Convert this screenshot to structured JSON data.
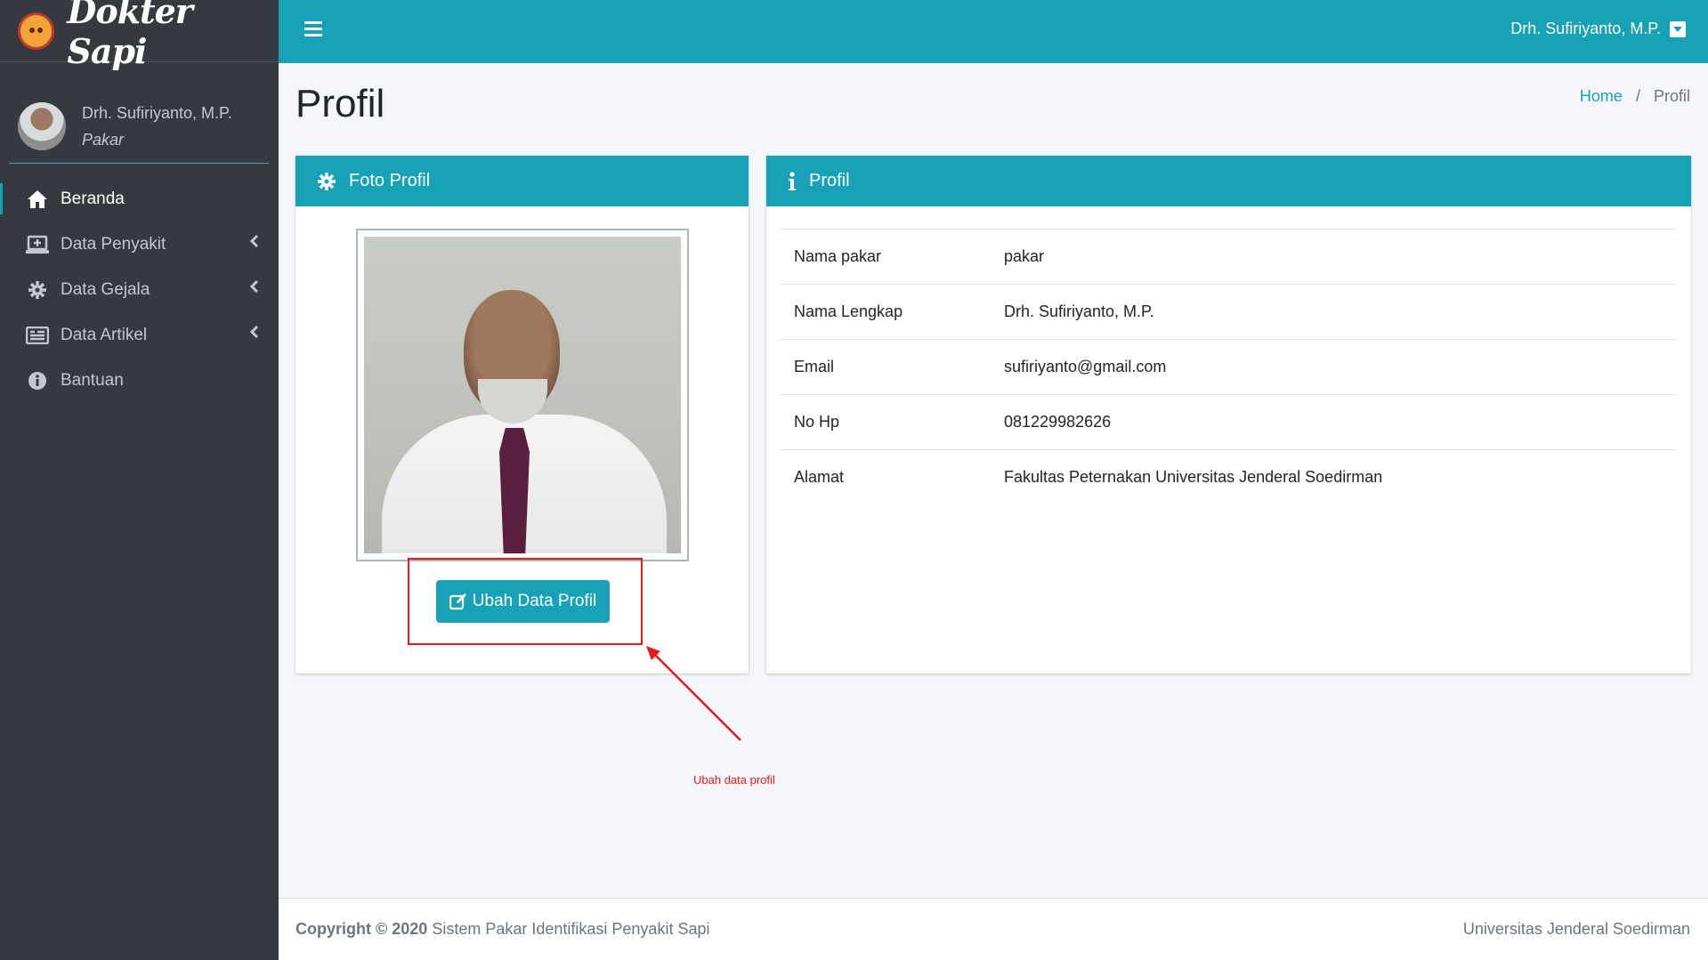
{
  "brand": {
    "name": "Dokter Sapi",
    "logo_icon": "cow-logo-icon"
  },
  "sidebar": {
    "user": {
      "name": "Drh. Sufiriyanto, M.P.",
      "role": "Pakar"
    },
    "items": [
      {
        "label": "Beranda",
        "icon": "home-icon",
        "active": true,
        "has_children": false
      },
      {
        "label": "Data Penyakit",
        "icon": "laptop-medical-icon",
        "active": false,
        "has_children": true
      },
      {
        "label": "Data Gejala",
        "icon": "cog-icon",
        "active": false,
        "has_children": true
      },
      {
        "label": "Data Artikel",
        "icon": "newspaper-icon",
        "active": false,
        "has_children": true
      },
      {
        "label": "Bantuan",
        "icon": "info-circle-icon",
        "active": false,
        "has_children": false
      }
    ]
  },
  "topbar": {
    "user_name": "Drh. Sufiriyanto, M.P."
  },
  "page": {
    "title": "Profil",
    "breadcrumb": {
      "home": "Home",
      "separator": "/",
      "current": "Profil"
    }
  },
  "photo_card": {
    "title": "Foto Profil",
    "button_label": "Ubah Data Profil"
  },
  "profile_card": {
    "title": "Profil",
    "rows": [
      {
        "label": "Nama pakar",
        "value": "pakar"
      },
      {
        "label": "Nama Lengkap",
        "value": "Drh. Sufiriyanto, M.P."
      },
      {
        "label": "Email",
        "value": "sufiriyanto@gmail.com"
      },
      {
        "label": "No Hp",
        "value": "081229982626"
      },
      {
        "label": "Alamat",
        "value": "Fakultas Peternakan Universitas Jenderal Soedirman"
      }
    ]
  },
  "annotation": {
    "text": "Ubah data profil",
    "color": "#e41a1a"
  },
  "footer": {
    "copyright_bold": "Copyright © 2020",
    "copyright_text": "Sistem Pakar Identifikasi Penyakit Sapi",
    "right_text": "Universitas Jenderal Soedirman"
  },
  "colors": {
    "accent": "#17a2b8",
    "sidebar_bg": "#343a40",
    "content_bg": "#f4f6f9"
  }
}
